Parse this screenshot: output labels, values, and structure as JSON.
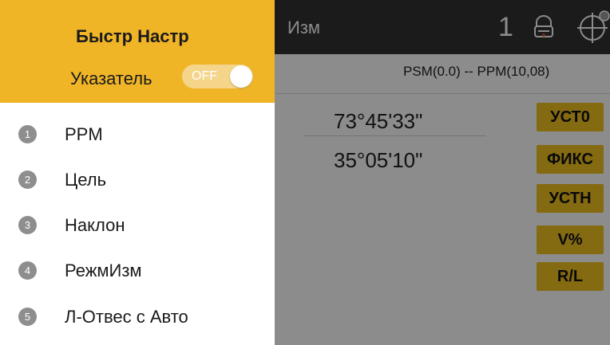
{
  "app": {
    "title": "Изм",
    "page_number": "1",
    "ppm_status": "PSM(0.0) -- PPM(10,08)",
    "values": [
      "73°45'33\"",
      "35°05'10\""
    ],
    "side_buttons": [
      "УСТ0",
      "ФИКС",
      "УСТН",
      "V%",
      "R/L"
    ],
    "icons": [
      "prism-icon",
      "crosshair-target-icon"
    ]
  },
  "drawer": {
    "title": "Быстр Настр",
    "pointer_label": "Указатель",
    "pointer_toggle": {
      "text": "OFF",
      "state": "off"
    },
    "items": [
      {
        "num": "1",
        "label": "PPM"
      },
      {
        "num": "2",
        "label": "Цель"
      },
      {
        "num": "3",
        "label": "Наклон"
      },
      {
        "num": "4",
        "label": "РежмИзм"
      },
      {
        "num": "5",
        "label": "Л-Отвес с Авто"
      }
    ]
  },
  "colors": {
    "accent": "#f0b527",
    "button": "#f0c21f",
    "topbar": "#323232",
    "number_badge": "#8e8e8e"
  }
}
